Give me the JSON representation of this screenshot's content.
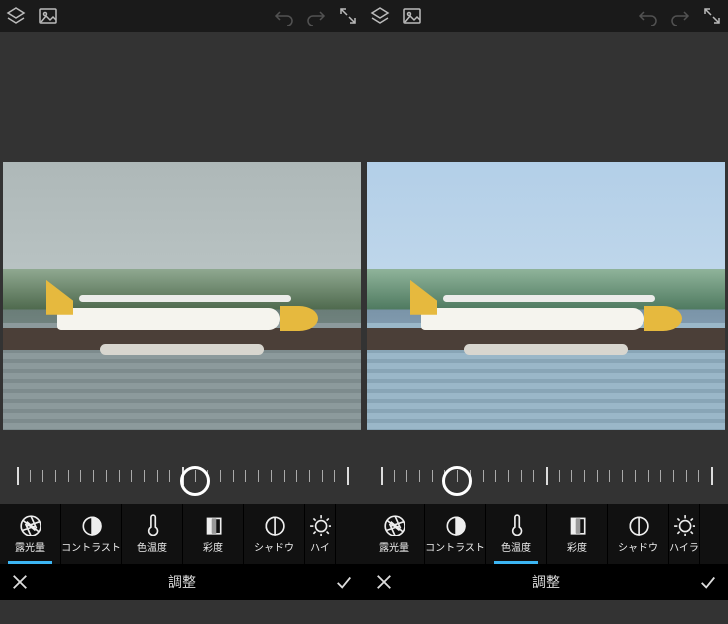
{
  "panes": [
    {
      "id": "left",
      "slider_position_pct": 53,
      "active_tool_index": 0,
      "adjust_tools": [
        {
          "id": "exposure",
          "label": "露光量"
        },
        {
          "id": "contrast",
          "label": "コントラスト"
        },
        {
          "id": "temperature",
          "label": "色温度"
        },
        {
          "id": "saturation",
          "label": "彩度"
        },
        {
          "id": "shadows",
          "label": "シャドウ"
        },
        {
          "id": "highlights",
          "label": "ハイ"
        }
      ],
      "bottom_title": "調整"
    },
    {
      "id": "right",
      "slider_position_pct": 22,
      "active_tool_index": 2,
      "adjust_tools": [
        {
          "id": "exposure",
          "label": "露光量"
        },
        {
          "id": "contrast",
          "label": "コントラスト"
        },
        {
          "id": "temperature",
          "label": "色温度"
        },
        {
          "id": "saturation",
          "label": "彩度"
        },
        {
          "id": "shadows",
          "label": "シャドウ"
        },
        {
          "id": "highlights",
          "label": "ハイラ"
        }
      ],
      "bottom_title": "調整"
    }
  ],
  "icons": {
    "layers": "layers-icon",
    "image": "image-icon",
    "undo": "undo-icon",
    "redo": "redo-icon",
    "expand": "expand-icon",
    "close": "close-icon",
    "check": "check-icon"
  }
}
